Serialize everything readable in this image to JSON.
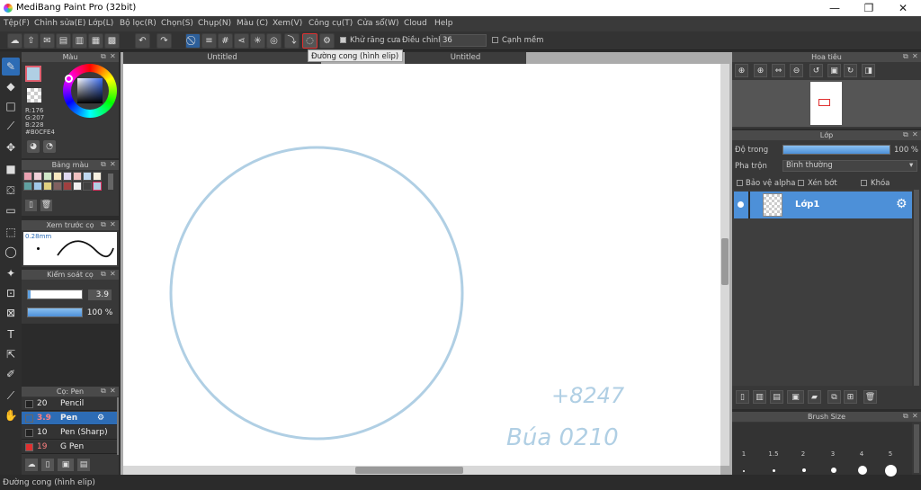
{
  "window": {
    "title": "MediBang Paint Pro (32bit)",
    "minimize": "—",
    "maximize": "❐",
    "close": "✕"
  },
  "menu": [
    "Tệp(F)",
    "Chỉnh sửa(E)",
    "Lớp(L)",
    "Bộ lọc(R)",
    "Chọn(S)",
    "Chụp(N)",
    "Màu (C)",
    "Xem(V)",
    "Công cụ(T)",
    "Cửa sổ(W)",
    "Cloud",
    "Help"
  ],
  "toolbar": {
    "antialias_label": "Khử răng cưa",
    "adjust_label": "Điều chỉnh",
    "adjust_value": "36",
    "edge_label": "Cạnh mềm",
    "tooltip": "Đường cong (hình elip)"
  },
  "tabs": {
    "document": "Untitled",
    "secondary": "Untitled"
  },
  "color_panel": {
    "title": "Màu",
    "r": "R:176",
    "g": "G:207",
    "b": "B:228",
    "hex": "#B0CFE4",
    "accent": "#b0cfe4"
  },
  "palette_panel": {
    "title": "Bảng màu"
  },
  "brush_preview_panel": {
    "title": "Xem trước cọ",
    "size_text": "0.28mm"
  },
  "brush_control_panel": {
    "title": "Kiểm soát cọ",
    "size_value": "3.9",
    "opacity_value": "100 %"
  },
  "brush_list_panel": {
    "title": "Cọ: Pen",
    "items": [
      {
        "size": "20",
        "name": "Pencil",
        "active": false
      },
      {
        "size": "3.9",
        "name": "Pen",
        "active": true
      },
      {
        "size": "10",
        "name": "Pen (Sharp)",
        "active": false
      },
      {
        "size": "19",
        "name": "G Pen",
        "active": false
      }
    ]
  },
  "navigator_panel": {
    "title": "Hoa tiêu"
  },
  "layer_panel": {
    "title": "Lớp",
    "opacity_label": "Độ trong",
    "opacity_value": "100 %",
    "blend_label": "Pha trộn",
    "blend_value": "Bình thường",
    "protect_alpha": "Bảo vệ alpha",
    "clipping": "Xén bớt",
    "lock": "Khóa",
    "layers": [
      {
        "name": "Lớp1",
        "selected": true
      }
    ]
  },
  "brush_size_panel": {
    "title": "Brush Size",
    "sizes": [
      "1",
      "1.5",
      "2",
      "3",
      "4",
      "5"
    ]
  },
  "canvas": {
    "annotation_line1": "+8247",
    "annotation_line2": "Búa 0210",
    "circle_color": "#b0cfe4"
  },
  "status": {
    "text": "Đường cong (hình elip)"
  }
}
